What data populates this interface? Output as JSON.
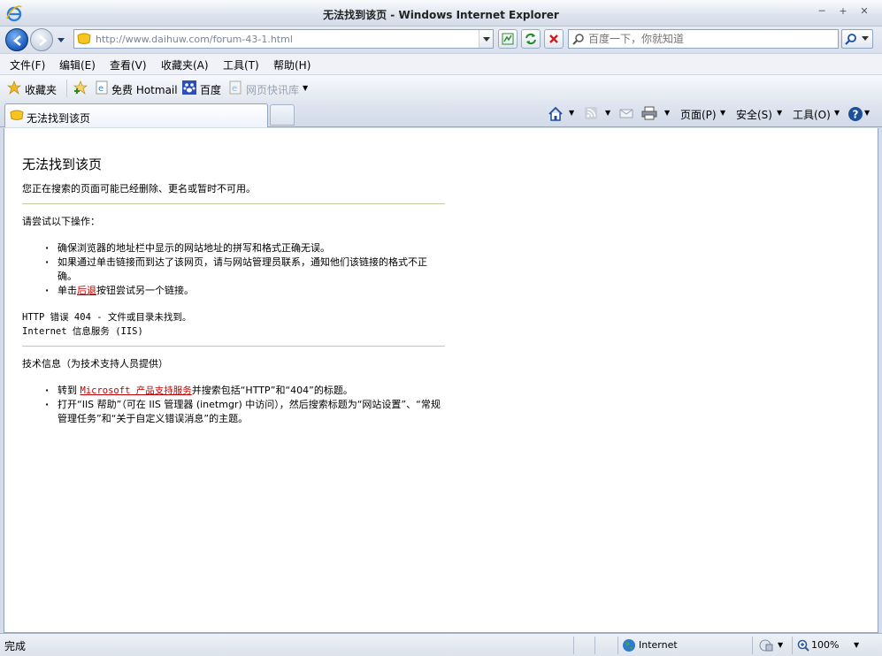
{
  "window": {
    "title": "无法找到该页 - Windows Internet Explorer"
  },
  "address": {
    "url": "http://www.daihuw.com/forum-43-1.html"
  },
  "search": {
    "placeholder": "百度一下，你就知道"
  },
  "menu": [
    "文件(F)",
    "编辑(E)",
    "查看(V)",
    "收藏夹(A)",
    "工具(T)",
    "帮助(H)"
  ],
  "favorites": {
    "label": "收藏夹",
    "items": [
      "免费 Hotmail",
      "百度",
      "网页快讯库"
    ]
  },
  "tab": {
    "label": "无法找到该页"
  },
  "commandbar": {
    "page": "页面(P)",
    "safety": "安全(S)",
    "tools": "工具(O)"
  },
  "error": {
    "title": "无法找到该页",
    "intro": "您正在搜索的页面可能已经删除、更名或暂时不可用。",
    "try_heading": "请尝试以下操作：",
    "bullets": [
      "确保浏览器的地址栏中显示的网站地址的拼写和格式正确无误。",
      "如果通过单击链接而到达了该网页，请与网站管理员联系，通知他们该链接的格式不正确。"
    ],
    "back_prefix": "单击",
    "back_link": "后退",
    "back_suffix": "按钮尝试另一个链接。",
    "http_error": "HTTP 错误 404 - 文件或目录未找到。",
    "iis": "Internet 信息服务 (IIS)",
    "tech_heading": "技术信息（为技术支持人员提供）",
    "tech_prefix": "转到",
    "tech_link": "Microsoft 产品支持服务",
    "tech_suffix": "并搜索包括“HTTP”和“404”的标题。",
    "tech_bullet2": "打开“IIS 帮助”（可在 IIS 管理器 (inetmgr) 中访问），然后搜索标题为“网站设置”、“常规管理任务”和“关于自定义错误消息”的主题。"
  },
  "status": {
    "text": "完成",
    "zone": "Internet",
    "zoom": "100%"
  }
}
